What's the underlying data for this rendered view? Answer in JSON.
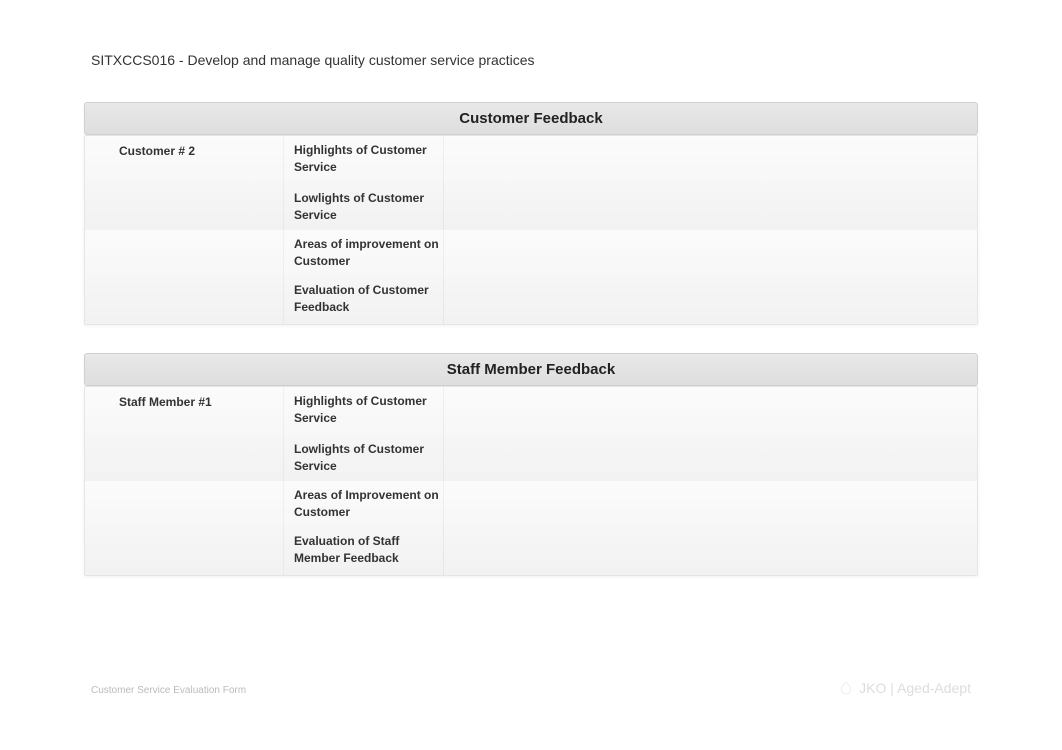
{
  "header": {
    "course_title": "SITXCCS016 - Develop and manage quality customer service practices"
  },
  "sections": [
    {
      "title": "Customer Feedback",
      "participant_label": "Customer # 2",
      "rows": [
        {
          "label": "Highlights of Customer Service",
          "value": ""
        },
        {
          "label": "Lowlights of Customer Service",
          "value": ""
        },
        {
          "label": "Areas of improvement on Customer",
          "value": ""
        },
        {
          "label": "Evaluation of Customer Feedback",
          "value": ""
        }
      ]
    },
    {
      "title": "Staff Member Feedback",
      "participant_label": "Staff Member #1",
      "rows": [
        {
          "label": "Highlights of Customer Service",
          "value": ""
        },
        {
          "label": "Lowlights of Customer Service",
          "value": ""
        },
        {
          "label": "Areas of Improvement on Customer",
          "value": ""
        },
        {
          "label": "Evaluation of Staff Member Feedback",
          "value": ""
        }
      ]
    }
  ],
  "footer": {
    "left": "Customer Service Evaluation Form",
    "brand": "JKO | Aged-Adept",
    "sub": ""
  }
}
